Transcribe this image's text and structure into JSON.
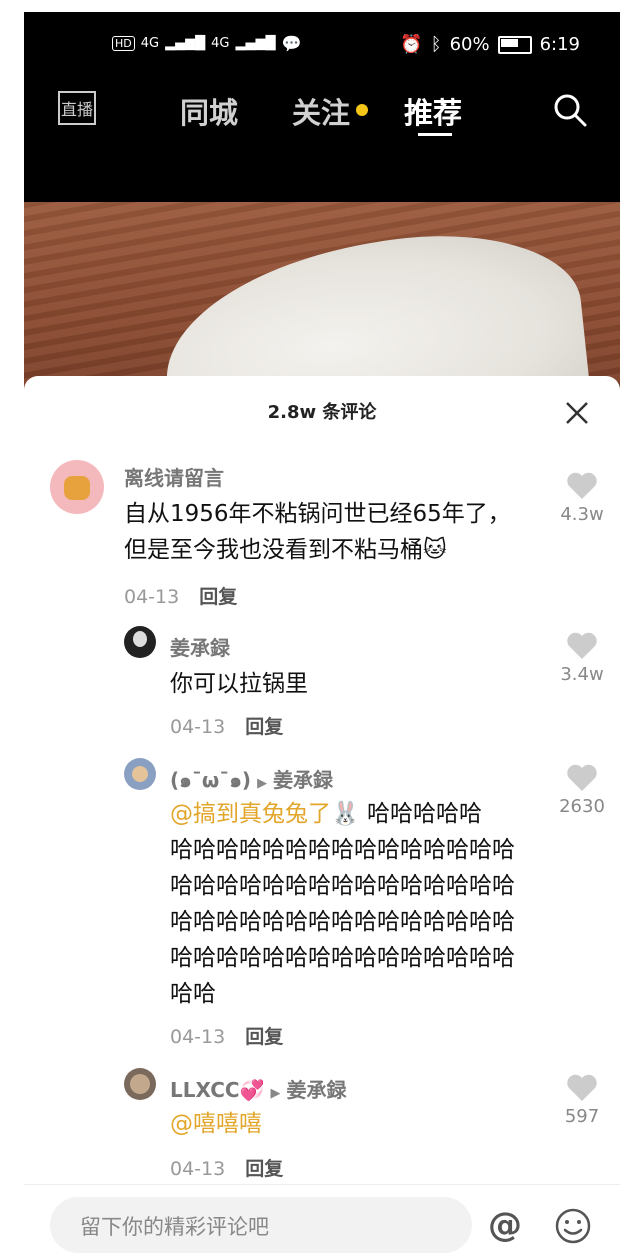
{
  "status": {
    "network": "4G",
    "network2": "4G",
    "battery": "60%",
    "time": "6:19",
    "hd": "HD"
  },
  "nav": {
    "live": "直播",
    "city": "同城",
    "follow": "关注",
    "recommend": "推荐"
  },
  "sheet": {
    "title": "2.8w 条评论"
  },
  "comments": [
    {
      "user": "离线请留言",
      "line1": "自从1956年不粘锅问世已经65年了，",
      "line2": "但是至今我也没看到不粘马桶",
      "date": "04-13",
      "reply": "回复",
      "likes": "4.3w"
    },
    {
      "user": "姜承録",
      "text": "你可以拉锅里",
      "date": "04-13",
      "reply": "回复",
      "likes": "3.4w"
    },
    {
      "user": "(๑¯ω¯๑)",
      "to": "姜承録",
      "mention": "@搞到真兔兔了",
      "text_l1": " 哈哈哈哈哈",
      "text_l2": "哈哈哈哈哈哈哈哈哈哈哈哈哈哈哈",
      "text_l3": "哈哈哈哈哈哈哈哈哈哈哈哈哈哈哈",
      "text_l4": "哈哈哈哈哈哈哈哈哈哈哈哈哈哈哈",
      "text_l5": "哈哈哈哈哈哈哈哈哈哈哈哈哈哈哈",
      "text_l6": "哈哈",
      "date": "04-13",
      "reply": "回复",
      "likes": "2630"
    },
    {
      "user": "LLXCC",
      "to": "姜承録",
      "mention": "@嘻嘻嘻",
      "date": "04-13",
      "reply": "回复",
      "likes": "597"
    }
  ],
  "input": {
    "placeholder": "留下你的精彩评论吧"
  },
  "colors": {
    "accent": "#f5c518",
    "mention": "#e2a62a"
  }
}
